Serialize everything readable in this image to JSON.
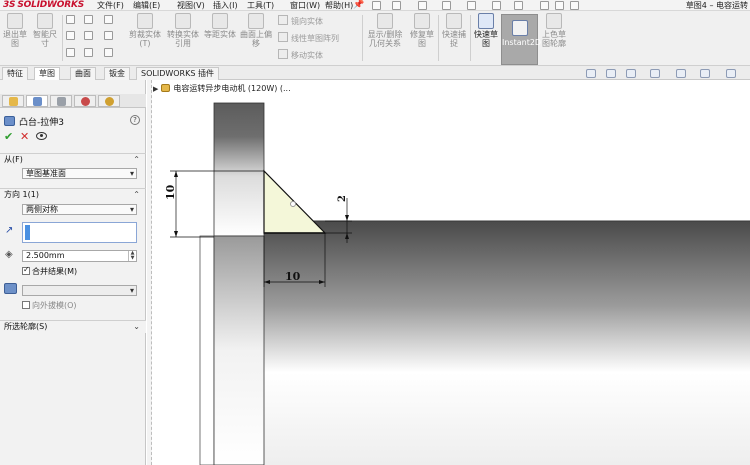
{
  "app": {
    "logo_prefix": "3S",
    "logo_text": "SOLIDWORKS",
    "doc_title": "草图4 – 电容运转"
  },
  "menu": [
    {
      "label": "文件(F)"
    },
    {
      "label": "编辑(E)"
    },
    {
      "label": "视图(V)"
    },
    {
      "label": "插入(I)"
    },
    {
      "label": "工具(T)"
    },
    {
      "label": "窗口(W)"
    },
    {
      "label": "帮助(H)"
    }
  ],
  "ribbon": {
    "big_tools": [
      {
        "label": "退出草图",
        "name": "exit-sketch-tool"
      },
      {
        "label": "智能尺寸",
        "name": "smart-dimension-tool"
      },
      {
        "label": "剪裁实体(T)",
        "name": "trim-entities-tool"
      },
      {
        "label": "转换实体引用",
        "name": "convert-entities-tool"
      },
      {
        "label": "等距实体",
        "name": "offset-entities-tool"
      },
      {
        "label": "曲面上偏移",
        "name": "offset-on-surface-tool"
      },
      {
        "label": "显示/删除几何关系",
        "name": "display-relations-tool"
      },
      {
        "label": "修复草图",
        "name": "repair-sketch-tool"
      },
      {
        "label": "快速捕捉",
        "name": "quick-snaps-tool"
      },
      {
        "label": "快速草图",
        "name": "rapid-sketch-tool"
      },
      {
        "label": "Instant2D",
        "name": "instant2d-tool"
      },
      {
        "label": "上色草图轮廓",
        "name": "shaded-sketch-contours-tool"
      }
    ],
    "small_tools": [
      {
        "label": "镜向实体"
      },
      {
        "label": "线性草图阵列"
      },
      {
        "label": "移动实体"
      }
    ]
  },
  "tabs": [
    {
      "label": "特征"
    },
    {
      "label": "草图"
    },
    {
      "label": "曲面"
    },
    {
      "label": "钣金"
    },
    {
      "label": "SOLIDWORKS 插件"
    }
  ],
  "property_manager": {
    "title": "凸台-拉伸3",
    "help": "?",
    "ok": "✔",
    "cancel": "✕",
    "from_group": {
      "label": "从(F)",
      "value": "草图基准面"
    },
    "direction_group": {
      "label": "方向 1(1)",
      "end_condition": "两侧对称",
      "depth": "2.500mm",
      "merge_result": "合并结果(M)",
      "merge_result_checked": true,
      "draft_outward": "向外拔模(O)",
      "draft_outward_checked": false
    },
    "contours_group": {
      "label": "所选轮廓(S)"
    }
  },
  "graphics": {
    "tree_label": "电容运转异步电动机 (120W) (..."
  },
  "drawing": {
    "dim_vertical": "10",
    "dim_horizontal": "10",
    "dim_small": "2"
  },
  "colors": {
    "logo_red": "#c8102e",
    "profile_fill": "#f4f7d9",
    "active_field": "#4a90e2"
  }
}
